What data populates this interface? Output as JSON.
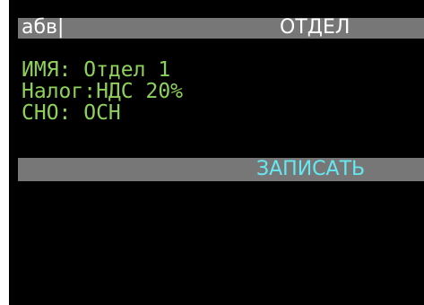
{
  "header": {
    "input_mode": "абв|",
    "title": "ОТДЕЛ"
  },
  "fields": [
    {
      "text": "ИМЯ: Отдел 1"
    },
    {
      "text": "Налог:НДС 20%"
    },
    {
      "text": "СНО: ОСН"
    }
  ],
  "actions": {
    "save_label": "ЗАПИСАТЬ"
  },
  "colors": {
    "screen_background": "#000000",
    "bar_background": "#777777",
    "header_text": "#ffffff",
    "field_text": "#8ed15a",
    "action_text": "#66e8f2"
  }
}
